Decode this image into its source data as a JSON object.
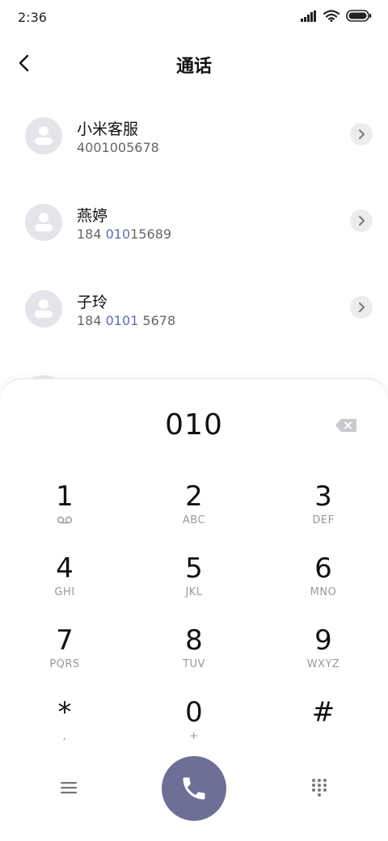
{
  "status_bar": {
    "time": "2:36"
  },
  "header": {
    "title": "通话"
  },
  "contacts": [
    {
      "name": "小米客服",
      "number_before": "4001005678",
      "number_match": "",
      "number_after": ""
    },
    {
      "name": "燕婷",
      "number_before": "184 ",
      "number_match": "010",
      "number_after": "15689"
    },
    {
      "name": "子玲",
      "number_before": "184 ",
      "number_match": "0101",
      "number_after": " 5678"
    }
  ],
  "dialer": {
    "input": "010",
    "keys": [
      {
        "digit": "1",
        "letters": ""
      },
      {
        "digit": "2",
        "letters": "ABC"
      },
      {
        "digit": "3",
        "letters": "DEF"
      },
      {
        "digit": "4",
        "letters": "GHI"
      },
      {
        "digit": "5",
        "letters": "JKL"
      },
      {
        "digit": "6",
        "letters": "MNO"
      },
      {
        "digit": "7",
        "letters": "PQRS"
      },
      {
        "digit": "8",
        "letters": "TUV"
      },
      {
        "digit": "9",
        "letters": "WXYZ"
      },
      {
        "digit": "*",
        "letters": ","
      },
      {
        "digit": "0",
        "letters": "+"
      },
      {
        "digit": "#",
        "letters": ""
      }
    ]
  },
  "icons": {
    "back": "back-arrow-icon",
    "chevron": "chevron-right-icon",
    "backspace": "backspace-icon",
    "voicemail": "voicemail-icon",
    "menu": "menu-icon",
    "call": "phone-icon",
    "keypad": "dialpad-icon"
  },
  "colors": {
    "call_button": "#6d6f96",
    "match_highlight": "#5b6fa8",
    "avatar_bg": "#e3e5ea"
  }
}
